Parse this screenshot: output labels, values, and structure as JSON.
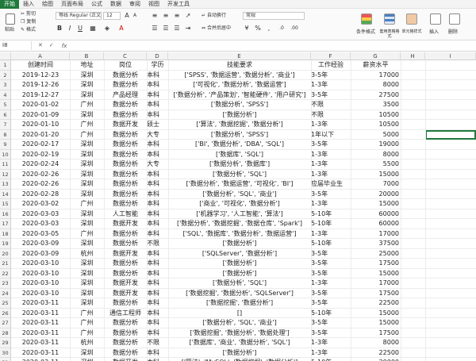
{
  "menu": [
    "开始",
    "插入",
    "绘图",
    "页面布局",
    "公式",
    "数据",
    "审阅",
    "视图",
    "开发工具"
  ],
  "ribbon": {
    "paste_label": "粘贴",
    "cut_label": "剪切",
    "copy_label": "复制",
    "format_painter_label": "格式",
    "font_name": "等线 Regular (正文)",
    "font_size": "12",
    "wrap_text_label": "自动换行",
    "merge_center_label": "合并后居中",
    "number_format": "常规",
    "conditional_format_label": "条件格式",
    "table_format_label": "套用表格格式",
    "cell_style_label": "单元格样式",
    "insert_label": "插入",
    "delete_label": "删除"
  },
  "formula_bar": {
    "name_box": "I8",
    "fx": "fx",
    "value": ""
  },
  "columns": [
    "A",
    "B",
    "C",
    "D",
    "E",
    "F",
    "G",
    "H",
    "I"
  ],
  "header": [
    "创建时间",
    "地址",
    "岗位",
    "学历",
    "技能要求",
    "工作经验",
    "薪资水平"
  ],
  "rows": [
    [
      "2019-12-23",
      "深圳",
      "数据分析",
      "本科",
      "['SPSS', '数据运营', '数据分析', '商业']",
      "3-5年",
      "17000"
    ],
    [
      "2019-12-26",
      "深圳",
      "数据分析",
      "本科",
      "['可视化', '数据分析', '数据运营']",
      "1-3年",
      "8000"
    ],
    [
      "2019-12-27",
      "深圳",
      "产品经理",
      "本科",
      "['数据分析', '产品策划', '智能硬件', '用户研究']",
      "3-5年",
      "27500"
    ],
    [
      "2020-01-02",
      "广州",
      "数据分析",
      "本科",
      "['数据分析', 'SPSS']",
      "不限",
      "3500"
    ],
    [
      "2020-01-09",
      "深圳",
      "数据分析",
      "本科",
      "['数据分析']",
      "不限",
      "10500"
    ],
    [
      "2020-01-10",
      "广州",
      "数据开发",
      "硕士",
      "['算法', '数据挖掘', '数据分析']",
      "1-3年",
      "10500"
    ],
    [
      "2020-01-20",
      "广州",
      "数据分析",
      "大专",
      "['数据分析', 'SPSS']",
      "1年以下",
      "5000"
    ],
    [
      "2020-02-17",
      "深圳",
      "数据分析",
      "本科",
      "['BI', '数据分析', 'DBA', 'SQL']",
      "3-5年",
      "19000"
    ],
    [
      "2020-02-19",
      "深圳",
      "数据分析",
      "本科",
      "['数据库', 'SQL']",
      "1-3年",
      "8000"
    ],
    [
      "2020-02-24",
      "深圳",
      "数据分析",
      "大专",
      "['数据分析', '数据库']",
      "1-3年",
      "5500"
    ],
    [
      "2020-02-26",
      "深圳",
      "数据分析",
      "本科",
      "['数据分析', 'SQL']",
      "1-3年",
      "15000"
    ],
    [
      "2020-02-26",
      "深圳",
      "数据分析",
      "本科",
      "['数据分析', '数据运营', '可视化', 'BI']",
      "应届毕业生",
      "7000"
    ],
    [
      "2020-02-28",
      "深圳",
      "数据分析",
      "本科",
      "['数据分析', 'SQL', '商业']",
      "3-5年",
      "20000"
    ],
    [
      "2020-03-02",
      "广州",
      "数据分析",
      "本科",
      "['商业', '可视化', '数据分析']",
      "1-3年",
      "15000"
    ],
    [
      "2020-03-03",
      "深圳",
      "人工智能",
      "本科",
      "['机器学习', '人工智能', '算法']",
      "5-10年",
      "60000"
    ],
    [
      "2020-03-03",
      "深圳",
      "数据开发",
      "本科",
      "['数据分析', '数据挖掘', '数据仓库', 'Spark']",
      "5-10年",
      "60000"
    ],
    [
      "2020-03-05",
      "广州",
      "数据分析",
      "本科",
      "['SQL', '数据库', '数据分析', '数据运营']",
      "1-3年",
      "17000"
    ],
    [
      "2020-03-09",
      "深圳",
      "数据分析",
      "不限",
      "['数据分析']",
      "5-10年",
      "37500"
    ],
    [
      "2020-03-09",
      "杭州",
      "数据开发",
      "本科",
      "['SQLServer', '数据分析']",
      "3-5年",
      "25000"
    ],
    [
      "2020-03-10",
      "深圳",
      "数据分析",
      "本科",
      "['数据分析']",
      "3-5年",
      "17500"
    ],
    [
      "2020-03-10",
      "深圳",
      "数据分析",
      "本科",
      "['数据分析']",
      "3-5年",
      "15000"
    ],
    [
      "2020-03-10",
      "深圳",
      "数据开发",
      "本科",
      "['数据分析', 'SQL']",
      "1-3年",
      "17000"
    ],
    [
      "2020-03-10",
      "深圳",
      "数据开发",
      "本科",
      "['数据挖掘', '数据分析', 'SQLServer']",
      "3-5年",
      "17500"
    ],
    [
      "2020-03-11",
      "深圳",
      "数据分析",
      "本科",
      "['数据挖掘', '数据分析']",
      "3-5年",
      "22500"
    ],
    [
      "2020-03-11",
      "广州",
      "通信工程师",
      "本科",
      "[]",
      "5-10年",
      "15000"
    ],
    [
      "2020-03-11",
      "广州",
      "数据分析",
      "本科",
      "['数据分析', 'SQL', '商业']",
      "3-5年",
      "15000"
    ],
    [
      "2020-03-11",
      "广州",
      "数据分析",
      "本科",
      "['数据挖掘', '数据分析', '数据处理']",
      "3-5年",
      "17500"
    ],
    [
      "2020-03-11",
      "杭州",
      "数据分析",
      "不限",
      "['数据库', '商业', '数据分析', 'SQL']",
      "1-3年",
      "8000"
    ],
    [
      "2020-03-11",
      "深圳",
      "数据分析",
      "本科",
      "['数据分析']",
      "1-3年",
      "22500"
    ],
    [
      "2020-03-11",
      "深圳",
      "数据开发",
      "本科",
      "['算法', 'MySQL', '数据挖掘', '数据分析']",
      "5-10年",
      "30000"
    ],
    [
      "2020-03-11",
      "深圳",
      "数据开发",
      "本科",
      "['数据仓库', '数据分析', '数据处理']",
      "不限",
      "27500"
    ]
  ]
}
